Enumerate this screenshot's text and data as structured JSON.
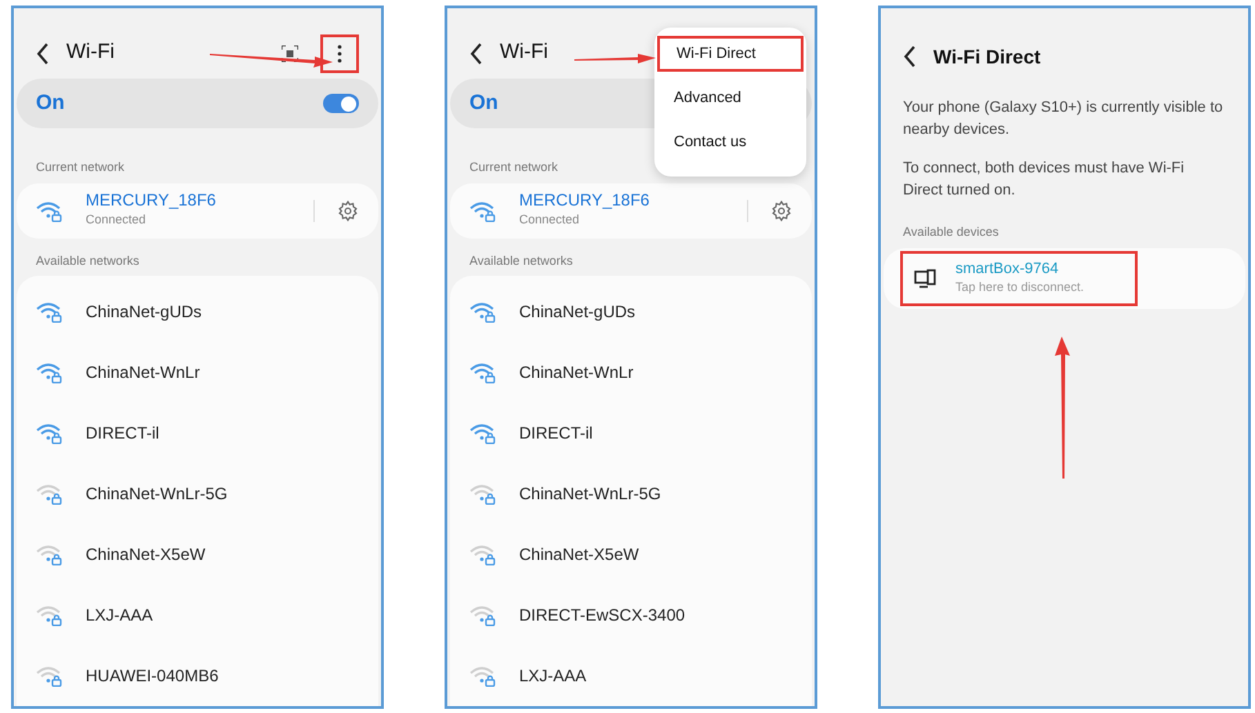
{
  "screens": [
    {
      "kind": "wifi",
      "title": "Wi-Fi",
      "qr": true,
      "more_button": {
        "highlighted": true
      },
      "toggle": {
        "label": "On",
        "on": true
      },
      "current_label": "Current network",
      "current": {
        "name": "MERCURY_18F6",
        "status": "Connected"
      },
      "available_label": "Available networks",
      "networks": [
        {
          "name": "ChinaNet-gUDs",
          "kind": "strong"
        },
        {
          "name": "ChinaNet-WnLr",
          "kind": "strong"
        },
        {
          "name": "DIRECT-il",
          "kind": "strong"
        },
        {
          "name": "ChinaNet-WnLr-5G",
          "kind": "weak"
        },
        {
          "name": "ChinaNet-X5eW",
          "kind": "weak"
        },
        {
          "name": "LXJ-AAA",
          "kind": "weak"
        },
        {
          "name": "HUAWEI-040MB6",
          "kind": "weak"
        }
      ],
      "annotation": {
        "kind": "arrow_to_icon"
      }
    },
    {
      "kind": "wifi",
      "title": "Wi-Fi",
      "toggle": {
        "label": "On"
      },
      "menu": [
        {
          "label": "Wi-Fi Direct",
          "highlighted": true
        },
        {
          "label": "Advanced",
          "highlighted": false
        },
        {
          "label": "Contact us",
          "highlighted": false
        }
      ],
      "current_label": "Current network",
      "current": {
        "name": "MERCURY_18F6",
        "status": "Connected"
      },
      "available_label": "Available networks",
      "networks": [
        {
          "name": "ChinaNet-gUDs",
          "kind": "strong"
        },
        {
          "name": "ChinaNet-WnLr",
          "kind": "strong"
        },
        {
          "name": "DIRECT-il",
          "kind": "strong"
        },
        {
          "name": "ChinaNet-WnLr-5G",
          "kind": "weak"
        },
        {
          "name": "ChinaNet-X5eW",
          "kind": "weak"
        },
        {
          "name": "DIRECT-EwSCX-3400",
          "kind": "weak"
        },
        {
          "name": "LXJ-AAA",
          "kind": "weak"
        }
      ],
      "annotation": {
        "kind": "arrow_to_menu"
      }
    },
    {
      "kind": "direct",
      "title": "Wi-Fi Direct",
      "paragraphs": [
        "Your phone (Galaxy S10+) is currently visible to nearby devices.",
        "To connect, both devices must have Wi-Fi Direct turned on."
      ],
      "devices_label": "Available devices",
      "devices": [
        {
          "name": "smartBox-9764",
          "status": "Tap here to disconnect.",
          "highlighted": true
        }
      ],
      "annotation": {
        "kind": "arrow_up"
      }
    }
  ]
}
